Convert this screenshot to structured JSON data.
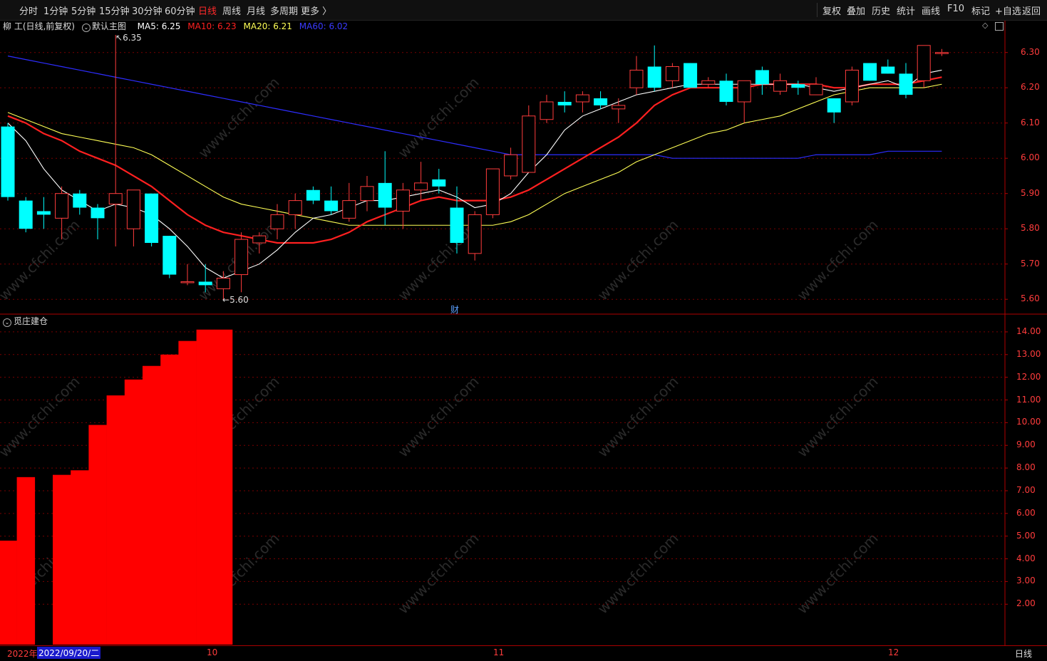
{
  "toolbar": {
    "periods": [
      "分时",
      "1分钟",
      "5分钟",
      "15分钟",
      "30分钟",
      "60分钟",
      "日线",
      "周线",
      "月线",
      "多周期",
      "更多 〉"
    ],
    "active_period": "日线",
    "right_buttons": [
      "复权",
      "叠加",
      "历史",
      "统计",
      "画线",
      "F10",
      "标记",
      "+自选",
      "返回"
    ]
  },
  "infobar": {
    "stock": "柳 工(日线,前复权)",
    "template": "默认主图",
    "ma5": "MA5: 6.25",
    "ma10": "MA10: 6.23",
    "ma20": "MA20: 6.21",
    "ma60": "MA60: 6.02"
  },
  "colors": {
    "up": "#ff3c3c",
    "down": "#00ffff",
    "ma5": "#ffffff",
    "ma10": "#ff2020",
    "ma20": "#ffff55",
    "ma60": "#2d2dff",
    "bar": "#ff0000",
    "grid": "#7a0000"
  },
  "price_axis": [
    "6.30",
    "6.20",
    "6.10",
    "6.00",
    "5.90",
    "5.80",
    "5.70",
    "5.60"
  ],
  "indicator_axis": [
    "14.00",
    "13.00",
    "12.00",
    "11.00",
    "10.00",
    "9.00",
    "8.00",
    "7.00",
    "6.00",
    "5.00",
    "4.00",
    "3.00",
    "2.00"
  ],
  "annotations": {
    "high": "6.35",
    "low": "5.60",
    "event": "财"
  },
  "indicator": {
    "name": "觅庄建仓"
  },
  "bottom": {
    "year": "2022年",
    "date": "2022/09/20/二",
    "months": [
      "10",
      "11",
      "12"
    ],
    "period_label": "日线"
  },
  "watermark": "www.cfchi.com",
  "chart_data": [
    {
      "type": "candlestick",
      "title": "柳 工(日线,前复权)",
      "ylim": [
        5.56,
        6.36
      ],
      "candles": [
        {
          "o": 6.09,
          "h": 6.1,
          "l": 5.88,
          "c": 5.89
        },
        {
          "o": 5.88,
          "h": 5.89,
          "l": 5.79,
          "c": 5.8
        },
        {
          "o": 5.85,
          "h": 5.89,
          "l": 5.8,
          "c": 5.84
        },
        {
          "o": 5.83,
          "h": 5.92,
          "l": 5.77,
          "c": 5.9
        },
        {
          "o": 5.9,
          "h": 5.91,
          "l": 5.84,
          "c": 5.86
        },
        {
          "o": 5.86,
          "h": 5.87,
          "l": 5.77,
          "c": 5.83
        },
        {
          "o": 5.87,
          "h": 6.35,
          "l": 5.75,
          "c": 5.9
        },
        {
          "o": 5.8,
          "h": 5.91,
          "l": 5.75,
          "c": 5.91
        },
        {
          "o": 5.9,
          "h": 5.9,
          "l": 5.75,
          "c": 5.76
        },
        {
          "o": 5.78,
          "h": 5.78,
          "l": 5.66,
          "c": 5.67
        },
        {
          "o": 5.65,
          "h": 5.7,
          "l": 5.64,
          "c": 5.65
        },
        {
          "o": 5.65,
          "h": 5.7,
          "l": 5.62,
          "c": 5.64
        },
        {
          "o": 5.63,
          "h": 5.68,
          "l": 5.6,
          "c": 5.66
        },
        {
          "o": 5.67,
          "h": 5.79,
          "l": 5.62,
          "c": 5.77
        },
        {
          "o": 5.76,
          "h": 5.79,
          "l": 5.73,
          "c": 5.78
        },
        {
          "o": 5.8,
          "h": 5.87,
          "l": 5.77,
          "c": 5.84
        },
        {
          "o": 5.84,
          "h": 5.9,
          "l": 5.8,
          "c": 5.88
        },
        {
          "o": 5.91,
          "h": 5.92,
          "l": 5.87,
          "c": 5.88
        },
        {
          "o": 5.88,
          "h": 5.92,
          "l": 5.84,
          "c": 5.85
        },
        {
          "o": 5.83,
          "h": 5.93,
          "l": 5.82,
          "c": 5.88
        },
        {
          "o": 5.88,
          "h": 5.95,
          "l": 5.85,
          "c": 5.92
        },
        {
          "o": 5.93,
          "h": 6.02,
          "l": 5.81,
          "c": 5.86
        },
        {
          "o": 5.85,
          "h": 5.93,
          "l": 5.8,
          "c": 5.91
        },
        {
          "o": 5.91,
          "h": 5.99,
          "l": 5.88,
          "c": 5.93
        },
        {
          "o": 5.94,
          "h": 5.97,
          "l": 5.9,
          "c": 5.92
        },
        {
          "o": 5.86,
          "h": 5.92,
          "l": 5.73,
          "c": 5.76
        },
        {
          "o": 5.73,
          "h": 5.85,
          "l": 5.71,
          "c": 5.84
        },
        {
          "o": 5.84,
          "h": 5.97,
          "l": 5.83,
          "c": 5.97
        },
        {
          "o": 5.95,
          "h": 6.03,
          "l": 5.94,
          "c": 6.01
        },
        {
          "o": 5.96,
          "h": 6.15,
          "l": 5.96,
          "c": 6.12
        },
        {
          "o": 6.11,
          "h": 6.18,
          "l": 6.1,
          "c": 6.16
        },
        {
          "o": 6.16,
          "h": 6.19,
          "l": 6.13,
          "c": 6.15
        },
        {
          "o": 6.16,
          "h": 6.19,
          "l": 6.13,
          "c": 6.18
        },
        {
          "o": 6.17,
          "h": 6.19,
          "l": 6.14,
          "c": 6.15
        },
        {
          "o": 6.14,
          "h": 6.17,
          "l": 6.1,
          "c": 6.15
        },
        {
          "o": 6.2,
          "h": 6.29,
          "l": 6.18,
          "c": 6.25
        },
        {
          "o": 6.26,
          "h": 6.32,
          "l": 6.19,
          "c": 6.2
        },
        {
          "o": 6.22,
          "h": 6.27,
          "l": 6.2,
          "c": 6.26
        },
        {
          "o": 6.27,
          "h": 6.27,
          "l": 6.2,
          "c": 6.2
        },
        {
          "o": 6.21,
          "h": 6.23,
          "l": 6.2,
          "c": 6.22
        },
        {
          "o": 6.22,
          "h": 6.24,
          "l": 6.15,
          "c": 6.16
        },
        {
          "o": 6.16,
          "h": 6.22,
          "l": 6.1,
          "c": 6.22
        },
        {
          "o": 6.25,
          "h": 6.26,
          "l": 6.18,
          "c": 6.21
        },
        {
          "o": 6.19,
          "h": 6.24,
          "l": 6.18,
          "c": 6.22
        },
        {
          "o": 6.21,
          "h": 6.22,
          "l": 6.18,
          "c": 6.2
        },
        {
          "o": 6.18,
          "h": 6.23,
          "l": 6.18,
          "c": 6.21
        },
        {
          "o": 6.17,
          "h": 6.13,
          "l": 6.1,
          "c": 6.13
        },
        {
          "o": 6.16,
          "h": 6.26,
          "l": 6.15,
          "c": 6.25
        },
        {
          "o": 6.27,
          "h": 6.27,
          "l": 6.22,
          "c": 6.22
        },
        {
          "o": 6.26,
          "h": 6.28,
          "l": 6.24,
          "c": 6.24
        },
        {
          "o": 6.24,
          "h": 6.27,
          "l": 6.17,
          "c": 6.18
        },
        {
          "o": 6.22,
          "h": 6.32,
          "l": 6.2,
          "c": 6.32
        },
        {
          "o": 6.3,
          "h": 6.31,
          "l": 6.29,
          "c": 6.3
        }
      ],
      "ma5": [
        6.1,
        6.05,
        5.97,
        5.91,
        5.88,
        5.85,
        5.87,
        5.86,
        5.84,
        5.8,
        5.75,
        5.69,
        5.66,
        5.68,
        5.7,
        5.74,
        5.79,
        5.83,
        5.84,
        5.86,
        5.88,
        5.88,
        5.89,
        5.9,
        5.91,
        5.89,
        5.86,
        5.87,
        5.9,
        5.96,
        6.01,
        6.08,
        6.12,
        6.14,
        6.16,
        6.18,
        6.19,
        6.2,
        6.21,
        6.21,
        6.21,
        6.21,
        6.21,
        6.21,
        6.21,
        6.2,
        6.19,
        6.2,
        6.21,
        6.22,
        6.2,
        6.24,
        6.25
      ],
      "ma10": [
        6.12,
        6.1,
        6.07,
        6.05,
        6.02,
        6.0,
        5.98,
        5.95,
        5.92,
        5.88,
        5.84,
        5.81,
        5.79,
        5.78,
        5.77,
        5.76,
        5.76,
        5.76,
        5.77,
        5.79,
        5.82,
        5.84,
        5.86,
        5.88,
        5.89,
        5.88,
        5.88,
        5.88,
        5.89,
        5.91,
        5.94,
        5.97,
        6.0,
        6.03,
        6.06,
        6.1,
        6.15,
        6.18,
        6.2,
        6.2,
        6.2,
        6.2,
        6.21,
        6.21,
        6.21,
        6.21,
        6.2,
        6.2,
        6.21,
        6.21,
        6.21,
        6.22,
        6.23
      ],
      "ma20": [
        6.13,
        6.11,
        6.09,
        6.07,
        6.06,
        6.05,
        6.04,
        6.03,
        6.01,
        5.98,
        5.95,
        5.92,
        5.89,
        5.87,
        5.86,
        5.85,
        5.84,
        5.83,
        5.82,
        5.81,
        5.81,
        5.81,
        5.81,
        5.81,
        5.81,
        5.81,
        5.81,
        5.81,
        5.82,
        5.84,
        5.87,
        5.9,
        5.92,
        5.94,
        5.96,
        5.99,
        6.01,
        6.03,
        6.05,
        6.07,
        6.08,
        6.1,
        6.11,
        6.12,
        6.14,
        6.16,
        6.18,
        6.19,
        6.2,
        6.2,
        6.2,
        6.2,
        6.21
      ],
      "ma60": [
        6.29,
        6.28,
        6.27,
        6.26,
        6.25,
        6.24,
        6.23,
        6.22,
        6.21,
        6.2,
        6.19,
        6.18,
        6.17,
        6.16,
        6.15,
        6.14,
        6.13,
        6.12,
        6.11,
        6.1,
        6.09,
        6.08,
        6.07,
        6.06,
        6.05,
        6.04,
        6.03,
        6.02,
        6.01,
        6.01,
        6.01,
        6.01,
        6.01,
        6.01,
        6.01,
        6.01,
        6.01,
        6.0,
        6.0,
        6.0,
        6.0,
        6.0,
        6.0,
        6.0,
        6.0,
        6.01,
        6.01,
        6.01,
        6.01,
        6.02,
        6.02,
        6.02,
        6.02
      ]
    },
    {
      "type": "bar",
      "title": "觅庄建仓",
      "ylim": [
        0,
        14.5
      ],
      "values": [
        4.8,
        7.6,
        0,
        7.7,
        7.9,
        9.9,
        11.2,
        11.9,
        12.5,
        13.0,
        13.6,
        14.1,
        14.1,
        0,
        0,
        0,
        0,
        0,
        0,
        0,
        0,
        0,
        0,
        0,
        0,
        0,
        0,
        0,
        0,
        0,
        0,
        0,
        0,
        0,
        0,
        0,
        0,
        0,
        0,
        0,
        0,
        0,
        0,
        0,
        0,
        0,
        0,
        0,
        0,
        0,
        0,
        0,
        0
      ]
    }
  ]
}
